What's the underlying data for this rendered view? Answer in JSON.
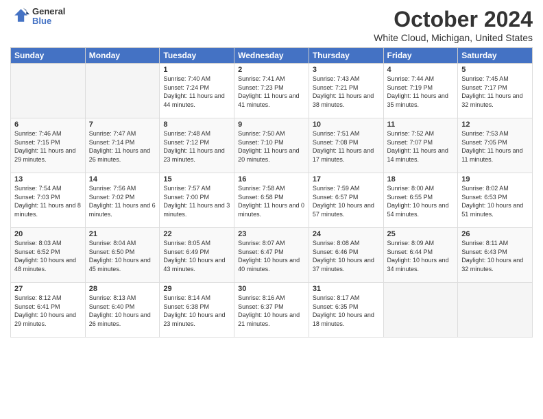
{
  "header": {
    "logo_line1": "General",
    "logo_line2": "Blue",
    "title": "October 2024",
    "subtitle": "White Cloud, Michigan, United States"
  },
  "columns": [
    "Sunday",
    "Monday",
    "Tuesday",
    "Wednesday",
    "Thursday",
    "Friday",
    "Saturday"
  ],
  "weeks": [
    [
      {
        "day": "",
        "sunrise": "",
        "sunset": "",
        "daylight": ""
      },
      {
        "day": "",
        "sunrise": "",
        "sunset": "",
        "daylight": ""
      },
      {
        "day": "1",
        "sunrise": "Sunrise: 7:40 AM",
        "sunset": "Sunset: 7:24 PM",
        "daylight": "Daylight: 11 hours and 44 minutes."
      },
      {
        "day": "2",
        "sunrise": "Sunrise: 7:41 AM",
        "sunset": "Sunset: 7:23 PM",
        "daylight": "Daylight: 11 hours and 41 minutes."
      },
      {
        "day": "3",
        "sunrise": "Sunrise: 7:43 AM",
        "sunset": "Sunset: 7:21 PM",
        "daylight": "Daylight: 11 hours and 38 minutes."
      },
      {
        "day": "4",
        "sunrise": "Sunrise: 7:44 AM",
        "sunset": "Sunset: 7:19 PM",
        "daylight": "Daylight: 11 hours and 35 minutes."
      },
      {
        "day": "5",
        "sunrise": "Sunrise: 7:45 AM",
        "sunset": "Sunset: 7:17 PM",
        "daylight": "Daylight: 11 hours and 32 minutes."
      }
    ],
    [
      {
        "day": "6",
        "sunrise": "Sunrise: 7:46 AM",
        "sunset": "Sunset: 7:15 PM",
        "daylight": "Daylight: 11 hours and 29 minutes."
      },
      {
        "day": "7",
        "sunrise": "Sunrise: 7:47 AM",
        "sunset": "Sunset: 7:14 PM",
        "daylight": "Daylight: 11 hours and 26 minutes."
      },
      {
        "day": "8",
        "sunrise": "Sunrise: 7:48 AM",
        "sunset": "Sunset: 7:12 PM",
        "daylight": "Daylight: 11 hours and 23 minutes."
      },
      {
        "day": "9",
        "sunrise": "Sunrise: 7:50 AM",
        "sunset": "Sunset: 7:10 PM",
        "daylight": "Daylight: 11 hours and 20 minutes."
      },
      {
        "day": "10",
        "sunrise": "Sunrise: 7:51 AM",
        "sunset": "Sunset: 7:08 PM",
        "daylight": "Daylight: 11 hours and 17 minutes."
      },
      {
        "day": "11",
        "sunrise": "Sunrise: 7:52 AM",
        "sunset": "Sunset: 7:07 PM",
        "daylight": "Daylight: 11 hours and 14 minutes."
      },
      {
        "day": "12",
        "sunrise": "Sunrise: 7:53 AM",
        "sunset": "Sunset: 7:05 PM",
        "daylight": "Daylight: 11 hours and 11 minutes."
      }
    ],
    [
      {
        "day": "13",
        "sunrise": "Sunrise: 7:54 AM",
        "sunset": "Sunset: 7:03 PM",
        "daylight": "Daylight: 11 hours and 8 minutes."
      },
      {
        "day": "14",
        "sunrise": "Sunrise: 7:56 AM",
        "sunset": "Sunset: 7:02 PM",
        "daylight": "Daylight: 11 hours and 6 minutes."
      },
      {
        "day": "15",
        "sunrise": "Sunrise: 7:57 AM",
        "sunset": "Sunset: 7:00 PM",
        "daylight": "Daylight: 11 hours and 3 minutes."
      },
      {
        "day": "16",
        "sunrise": "Sunrise: 7:58 AM",
        "sunset": "Sunset: 6:58 PM",
        "daylight": "Daylight: 11 hours and 0 minutes."
      },
      {
        "day": "17",
        "sunrise": "Sunrise: 7:59 AM",
        "sunset": "Sunset: 6:57 PM",
        "daylight": "Daylight: 10 hours and 57 minutes."
      },
      {
        "day": "18",
        "sunrise": "Sunrise: 8:00 AM",
        "sunset": "Sunset: 6:55 PM",
        "daylight": "Daylight: 10 hours and 54 minutes."
      },
      {
        "day": "19",
        "sunrise": "Sunrise: 8:02 AM",
        "sunset": "Sunset: 6:53 PM",
        "daylight": "Daylight: 10 hours and 51 minutes."
      }
    ],
    [
      {
        "day": "20",
        "sunrise": "Sunrise: 8:03 AM",
        "sunset": "Sunset: 6:52 PM",
        "daylight": "Daylight: 10 hours and 48 minutes."
      },
      {
        "day": "21",
        "sunrise": "Sunrise: 8:04 AM",
        "sunset": "Sunset: 6:50 PM",
        "daylight": "Daylight: 10 hours and 45 minutes."
      },
      {
        "day": "22",
        "sunrise": "Sunrise: 8:05 AM",
        "sunset": "Sunset: 6:49 PM",
        "daylight": "Daylight: 10 hours and 43 minutes."
      },
      {
        "day": "23",
        "sunrise": "Sunrise: 8:07 AM",
        "sunset": "Sunset: 6:47 PM",
        "daylight": "Daylight: 10 hours and 40 minutes."
      },
      {
        "day": "24",
        "sunrise": "Sunrise: 8:08 AM",
        "sunset": "Sunset: 6:46 PM",
        "daylight": "Daylight: 10 hours and 37 minutes."
      },
      {
        "day": "25",
        "sunrise": "Sunrise: 8:09 AM",
        "sunset": "Sunset: 6:44 PM",
        "daylight": "Daylight: 10 hours and 34 minutes."
      },
      {
        "day": "26",
        "sunrise": "Sunrise: 8:11 AM",
        "sunset": "Sunset: 6:43 PM",
        "daylight": "Daylight: 10 hours and 32 minutes."
      }
    ],
    [
      {
        "day": "27",
        "sunrise": "Sunrise: 8:12 AM",
        "sunset": "Sunset: 6:41 PM",
        "daylight": "Daylight: 10 hours and 29 minutes."
      },
      {
        "day": "28",
        "sunrise": "Sunrise: 8:13 AM",
        "sunset": "Sunset: 6:40 PM",
        "daylight": "Daylight: 10 hours and 26 minutes."
      },
      {
        "day": "29",
        "sunrise": "Sunrise: 8:14 AM",
        "sunset": "Sunset: 6:38 PM",
        "daylight": "Daylight: 10 hours and 23 minutes."
      },
      {
        "day": "30",
        "sunrise": "Sunrise: 8:16 AM",
        "sunset": "Sunset: 6:37 PM",
        "daylight": "Daylight: 10 hours and 21 minutes."
      },
      {
        "day": "31",
        "sunrise": "Sunrise: 8:17 AM",
        "sunset": "Sunset: 6:35 PM",
        "daylight": "Daylight: 10 hours and 18 minutes."
      },
      {
        "day": "",
        "sunrise": "",
        "sunset": "",
        "daylight": ""
      },
      {
        "day": "",
        "sunrise": "",
        "sunset": "",
        "daylight": ""
      }
    ]
  ]
}
